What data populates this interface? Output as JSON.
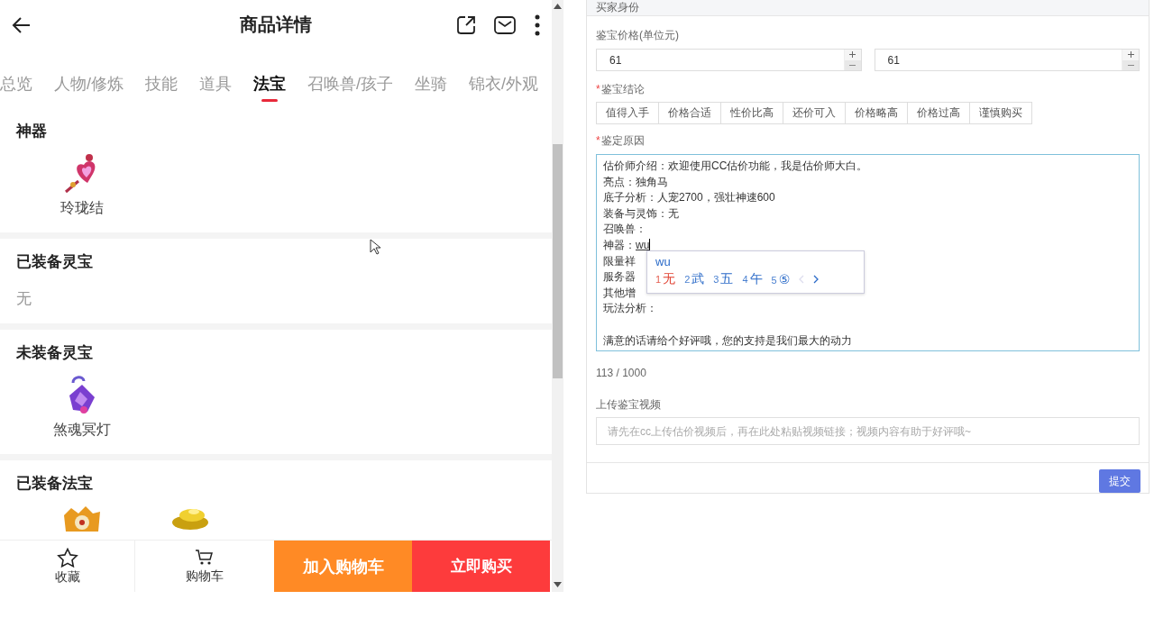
{
  "header": {
    "title": "商品详情"
  },
  "tabs": [
    {
      "label": "总览",
      "selected": false
    },
    {
      "label": "人物/修炼",
      "selected": false
    },
    {
      "label": "技能",
      "selected": false
    },
    {
      "label": "道具",
      "selected": false
    },
    {
      "label": "法宝",
      "selected": true
    },
    {
      "label": "召唤兽/孩子",
      "selected": false
    },
    {
      "label": "坐骑",
      "selected": false
    },
    {
      "label": "锦衣/外观",
      "selected": false
    }
  ],
  "sections": [
    {
      "title": "神器",
      "items": [
        {
          "name": "玲珑结",
          "kind": "pendant"
        }
      ]
    },
    {
      "title": "已装备灵宝",
      "empty_text": "无"
    },
    {
      "title": "未装备灵宝",
      "items": [
        {
          "name": "煞魂冥灯",
          "kind": "lantern"
        }
      ]
    },
    {
      "title": "已装备法宝",
      "items": [
        {
          "kind": "crest"
        },
        {
          "kind": "ingot"
        }
      ]
    }
  ],
  "bottom_bar": {
    "favorite": "收藏",
    "cart": "购物车",
    "add_to_cart": "加入购物车",
    "buy_now": "立即购买"
  },
  "form": {
    "section_title": "买家身份",
    "price_label": "鉴宝价格(单位元)",
    "price_inputs": [
      "61",
      "61"
    ],
    "conclusion_label": "鉴宝结论",
    "required_mark": "*",
    "conclusions": [
      {
        "label": "值得入手",
        "selected": false
      },
      {
        "label": "价格合适",
        "selected": false
      },
      {
        "label": "性价比高",
        "selected": false
      },
      {
        "label": "还价可入",
        "selected": false
      },
      {
        "label": "价格略高",
        "selected": false
      },
      {
        "label": "价格过高",
        "selected": false
      },
      {
        "label": "谨慎购买",
        "selected": false
      }
    ],
    "reason_label": "鉴定原因",
    "reason_lines": [
      {
        "text": "估价师介绍：欢迎使用CC估价功能，我是估价师大白。"
      },
      {
        "text": "亮点：独角马"
      },
      {
        "text": "底子分析：人宠2700，强壮神速600"
      },
      {
        "text": "装备与灵饰：无"
      },
      {
        "text": "召唤兽："
      },
      {
        "text": "神器：",
        "composing": "wu"
      },
      {
        "text": "限量祥"
      },
      {
        "text": "服务器"
      },
      {
        "text": "其他增"
      },
      {
        "text": "玩法分析："
      },
      {
        "text": "满意的话请给个好评哦，您的支持是我们最大的动力",
        "spaced": true
      }
    ],
    "counter": "113 / 1000",
    "video_label": "上传鉴宝视频",
    "video_placeholder": "请先在cc上传估价视频后，再在此处粘贴视频链接；视频内容有助于好评哦~",
    "submit": "提交"
  },
  "ime": {
    "composition": "wu",
    "prev_disabled": true,
    "candidates": [
      {
        "index": "1",
        "text": "无",
        "selected": true
      },
      {
        "index": "2",
        "text": "武",
        "selected": false
      },
      {
        "index": "3",
        "text": "五",
        "selected": false
      },
      {
        "index": "4",
        "text": "午",
        "selected": false
      },
      {
        "index": "5",
        "text": "⑤",
        "selected": false
      }
    ]
  }
}
